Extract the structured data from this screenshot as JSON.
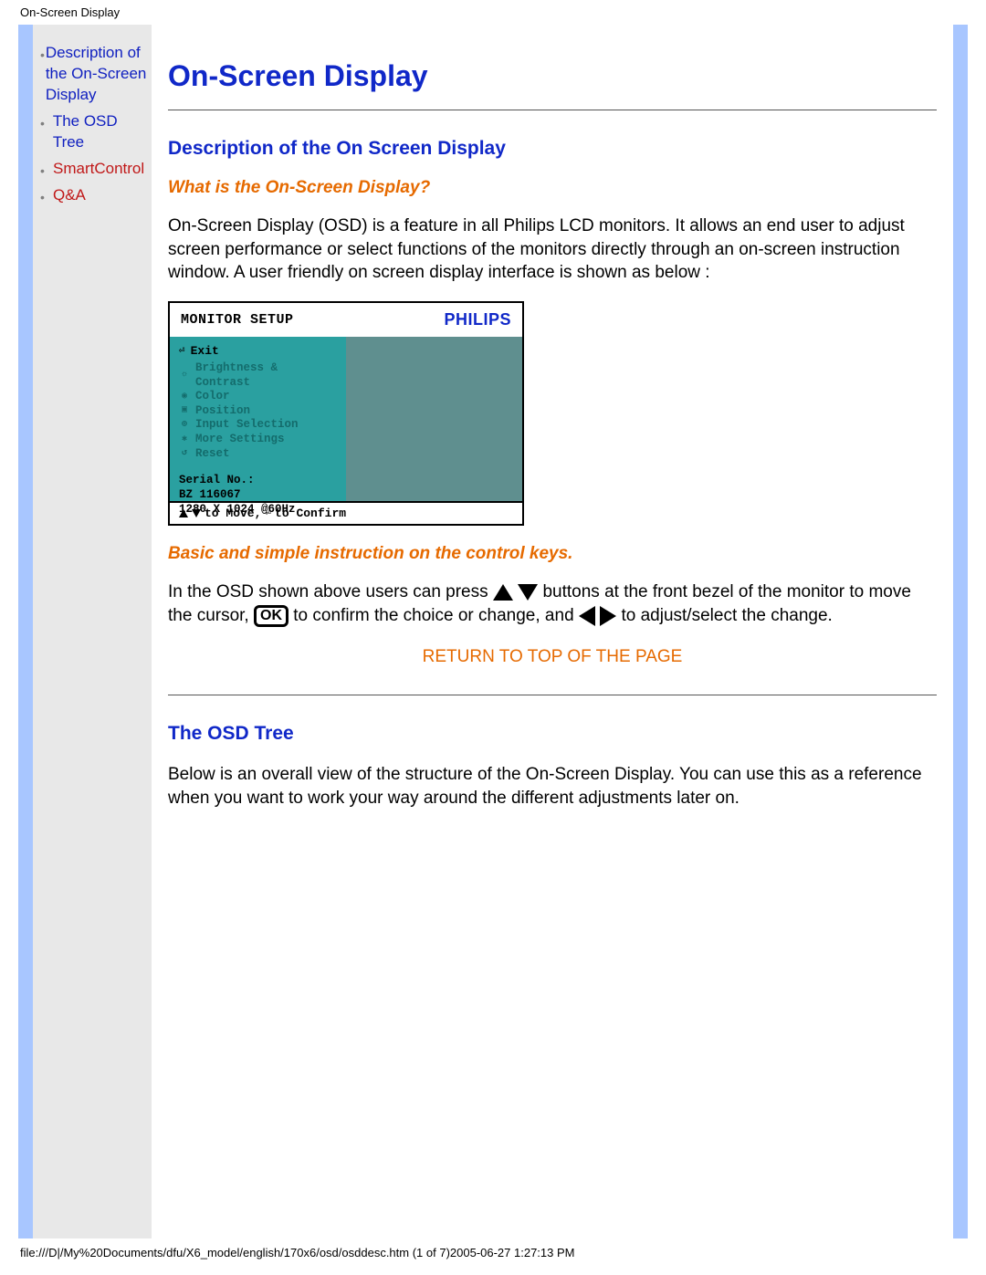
{
  "header": {
    "title": "On-Screen Display"
  },
  "sidebar": {
    "items": [
      {
        "label": "Description of the On-Screen Display"
      },
      {
        "label": "The OSD Tree"
      },
      {
        "label": "SmartControl"
      },
      {
        "label": "Q&A"
      }
    ]
  },
  "main": {
    "title": "On-Screen Display",
    "section1": {
      "heading": "Description of the On Screen Display",
      "sub1": "What is the On-Screen Display?",
      "para1": "On-Screen Display (OSD) is a feature in all Philips LCD monitors. It allows an end user to adjust screen performance or select functions of the monitors directly through an on-screen instruction window. A user friendly on screen display interface is shown as below :",
      "osd": {
        "title_left": "MONITOR SETUP",
        "title_right": "PHILIPS",
        "exit": "Exit",
        "menu": [
          "Brightness & Contrast",
          "Color",
          "Position",
          "Input Selection",
          "More Settings",
          "Reset"
        ],
        "serial_label": "Serial No.:",
        "serial_value": "BZ 116067",
        "resolution": "1280 X 1024 @60Hz",
        "footer_move": " to Move, ",
        "footer_confirm": " to Confirm"
      },
      "sub2": "Basic and simple instruction on the control keys.",
      "inst_a": "In the OSD shown above users can press",
      "inst_b": "buttons at the front bezel of the monitor to move the cursor,",
      "inst_c": "to confirm the choice or change, and",
      "inst_d": "to adjust/select the change.",
      "ok_label": "OK",
      "return": "RETURN TO TOP OF THE PAGE"
    },
    "section2": {
      "heading": "The OSD Tree",
      "para": "Below is an overall view of the structure of the On-Screen Display. You can use this as a reference when you want to work your way around the different adjustments later on."
    }
  },
  "footer": {
    "path": "file:///D|/My%20Documents/dfu/X6_model/english/170x6/osd/osddesc.htm (1 of 7)2005-06-27 1:27:13 PM"
  }
}
